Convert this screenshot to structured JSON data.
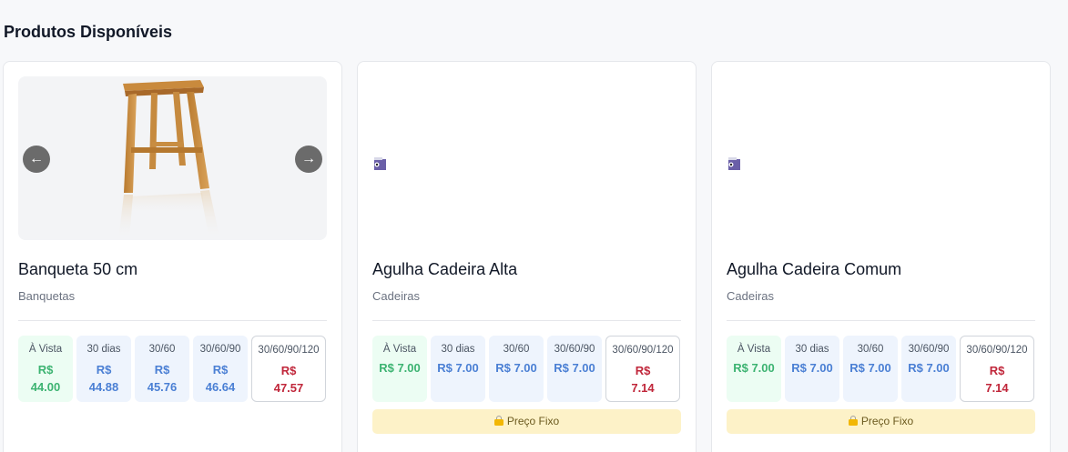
{
  "page": {
    "title": "Produtos Disponíveis"
  },
  "colors": {
    "vista": "#3cb371",
    "parcelado": "#4a7fd4",
    "prazo_longo": "#c0263a",
    "fixed_price_bg": "#fdf2c8"
  },
  "icons": {
    "prev": "arrow-left-icon",
    "next": "arrow-right-icon",
    "broken": "broken-image-icon",
    "lock": "lock-icon"
  },
  "products": [
    {
      "name": "Banqueta 50 cm",
      "category": "Banquetas",
      "prices": [
        {
          "label": "À Vista",
          "currency": "R$",
          "amount": "44.00"
        },
        {
          "label": "30 dias",
          "currency": "R$",
          "amount": "44.88"
        },
        {
          "label": "30/60",
          "currency": "R$",
          "amount": "45.76"
        },
        {
          "label": "30/60/90",
          "currency": "R$",
          "amount": "46.64"
        },
        {
          "label": "30/60/90/120",
          "currency": "R$",
          "amount": "47.57"
        }
      ]
    },
    {
      "name": "Agulha Cadeira Alta",
      "category": "Cadeiras",
      "prices": [
        {
          "label": "À Vista",
          "value": "R$ 7.00"
        },
        {
          "label": "30 dias",
          "value": "R$ 7.00"
        },
        {
          "label": "30/60",
          "value": "R$ 7.00"
        },
        {
          "label": "30/60/90",
          "value": "R$ 7.00"
        },
        {
          "label": "30/60/90/120",
          "currency": "R$",
          "amount": "7.14"
        }
      ],
      "fixed_price_label": "Preço Fixo"
    },
    {
      "name": "Agulha Cadeira Comum",
      "category": "Cadeiras",
      "prices": [
        {
          "label": "À Vista",
          "value": "R$ 7.00"
        },
        {
          "label": "30 dias",
          "value": "R$ 7.00"
        },
        {
          "label": "30/60",
          "value": "R$ 7.00"
        },
        {
          "label": "30/60/90",
          "value": "R$ 7.00"
        },
        {
          "label": "30/60/90/120",
          "currency": "R$",
          "amount": "7.14"
        }
      ],
      "fixed_price_label": "Preço Fixo"
    }
  ]
}
